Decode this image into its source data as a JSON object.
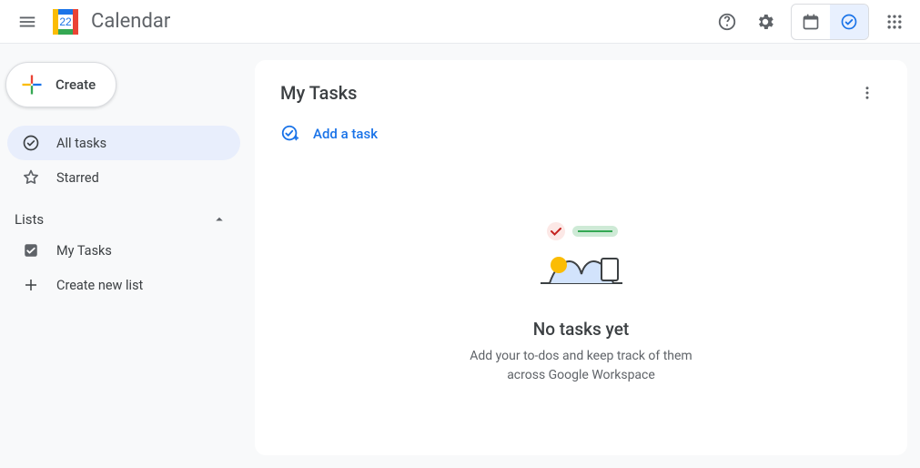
{
  "header": {
    "app_title": "Calendar",
    "logo_day": "22"
  },
  "create": {
    "label": "Create"
  },
  "sidebar": {
    "items": [
      {
        "label": "All tasks"
      },
      {
        "label": "Starred"
      }
    ],
    "lists_heading": "Lists",
    "lists": [
      {
        "label": "My Tasks"
      },
      {
        "label": "Create new list"
      }
    ]
  },
  "main": {
    "title": "My Tasks",
    "add_label": "Add a task",
    "empty_title": "No tasks yet",
    "empty_sub": "Add your to-dos and keep track of them across Google Workspace"
  },
  "colors": {
    "blue": "#1a73e8",
    "grey": "#5f6368"
  }
}
